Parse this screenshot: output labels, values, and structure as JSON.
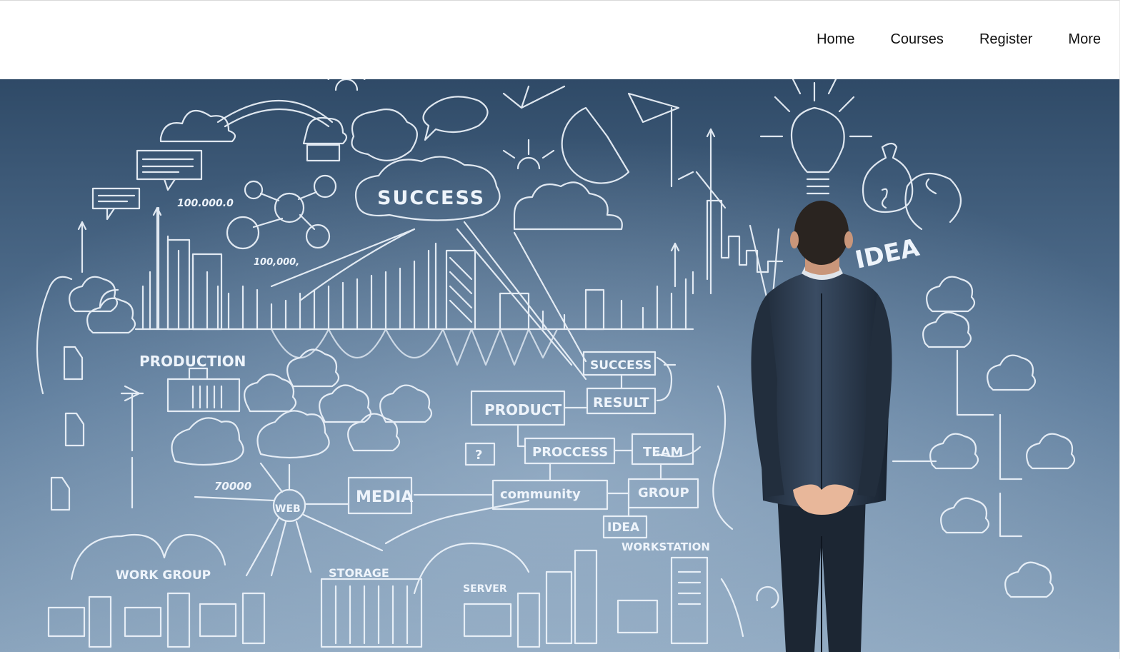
{
  "nav": {
    "items": [
      {
        "label": "Home"
      },
      {
        "label": "Courses"
      },
      {
        "label": "Register"
      },
      {
        "label": "More"
      }
    ]
  },
  "hero": {
    "sketch_words": {
      "success_top": "SUCCESS",
      "production": "PRODUCTION",
      "success_box": "SUCCESS",
      "result": "RESULT",
      "product": "PRODUCT",
      "process": "PROCCESS",
      "team": "TEAM",
      "media": "MEDIA",
      "community": "community",
      "group": "GROUP",
      "idea_box": "IDEA",
      "workstation": "WORKSTATION",
      "idea_big": "IDEA",
      "web": "WEB",
      "work_group": "WORK GROUP",
      "storage": "STORAGE",
      "server": "SERVER",
      "num_100000_0": "100.000.0",
      "num_100000": "100,000,",
      "num_70000": "70000",
      "question": "?"
    }
  }
}
